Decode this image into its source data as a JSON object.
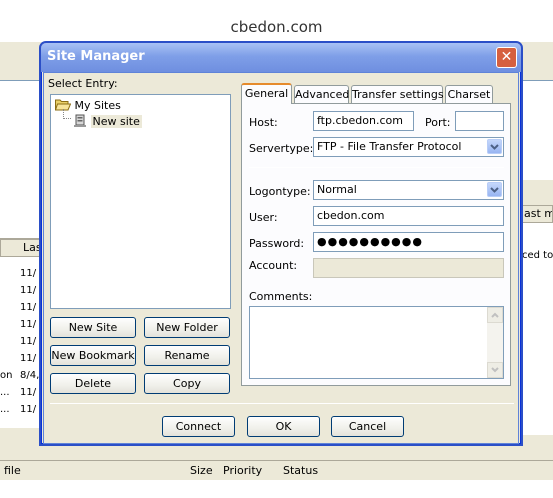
{
  "page": {
    "banner_title": "cbedon.com"
  },
  "background_app": {
    "left_column_header": "Las",
    "right_column_header": "ast mo",
    "right_text": "ced to",
    "left_rows": [
      "11/",
      "11/",
      "11/",
      "11/",
      "11/",
      "11/",
      "8/4,",
      "11/",
      "11/"
    ],
    "left_row_prefixes": [
      "",
      "",
      "",
      "",
      "",
      "",
      "on",
      "...",
      "..."
    ],
    "statusbar": {
      "file": "file",
      "size": "Size",
      "priority": "Priority",
      "status": "Status"
    }
  },
  "dialog": {
    "title": "Site Manager",
    "select_entry_label": "Select Entry:",
    "tree": {
      "root": "My Sites",
      "child": "New site"
    },
    "buttons": {
      "new_site": "New Site",
      "new_folder": "New Folder",
      "new_bookmark": "New Bookmark",
      "rename": "Rename",
      "delete": "Delete",
      "copy": "Copy"
    },
    "tabs": [
      "General",
      "Advanced",
      "Transfer settings",
      "Charset"
    ],
    "active_tab": "General",
    "general": {
      "host_label": "Host:",
      "host_value": "ftp.cbedon.com",
      "port_label": "Port:",
      "port_value": "",
      "servertype_label": "Servertype:",
      "servertype_value": "FTP - File Transfer Protocol",
      "logontype_label": "Logontype:",
      "logontype_value": "Normal",
      "user_label": "User:",
      "user_value": "cbedon.com",
      "password_label": "Password:",
      "password_value": "●●●●●●●●●●",
      "account_label": "Account:",
      "account_value": "",
      "comments_label": "Comments:",
      "comments_value": ""
    },
    "footer": {
      "connect": "Connect",
      "ok": "OK",
      "cancel": "Cancel"
    }
  },
  "colors": {
    "titlebar": "#7f9fe8",
    "dialog_bg": "#ece9d8",
    "active_tab_accent": "#e68b2c",
    "close_button": "#d6603f"
  }
}
